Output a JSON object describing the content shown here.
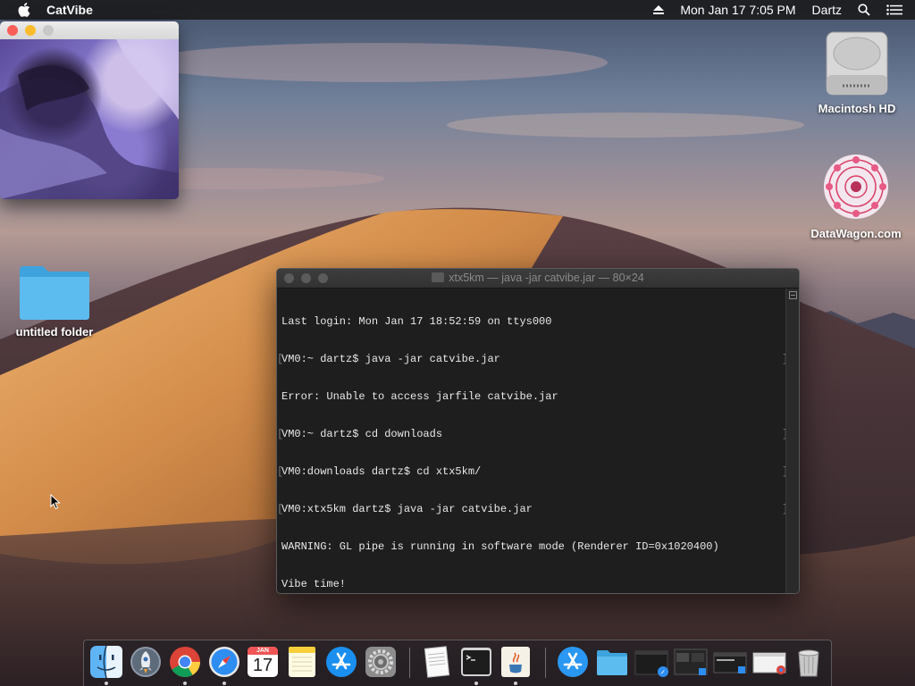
{
  "menubar": {
    "app_name": "CatVibe",
    "datetime": "Mon Jan 17  7:05 PM",
    "user": "Dartz",
    "icons": [
      "apple-icon",
      "eject-icon",
      "search-icon",
      "list-icon"
    ]
  },
  "catvibe_window": {
    "title": ""
  },
  "desktop": {
    "icons": [
      {
        "label": "Macintosh HD",
        "icon": "hard-drive-icon"
      },
      {
        "label": "DataWagon.com",
        "icon": "mandala-image-icon"
      },
      {
        "label": "untitled folder",
        "icon": "folder-icon"
      }
    ]
  },
  "terminal": {
    "title": "xtx5km — java -jar catvibe.jar — 80×24",
    "lines": [
      {
        "text": "Last login: Mon Jan 17 18:52:59 on ttys000",
        "marked": false
      },
      {
        "text": "VM0:~ dartz$ java -jar catvibe.jar",
        "marked": true
      },
      {
        "text": "Error: Unable to access jarfile catvibe.jar",
        "marked": false
      },
      {
        "text": "VM0:~ dartz$ cd downloads",
        "marked": true
      },
      {
        "text": "VM0:downloads dartz$ cd xtx5km/",
        "marked": true
      },
      {
        "text": "VM0:xtx5km dartz$ java -jar catvibe.jar",
        "marked": true
      },
      {
        "text": "WARNING: GL pipe is running in software mode (Renderer ID=0x1020400)",
        "marked": false
      },
      {
        "text": "Vibe time!",
        "marked": false
      }
    ]
  },
  "calendar_dock": {
    "month": "JAN",
    "day": "17"
  },
  "dock": {
    "items": [
      {
        "name": "finder",
        "icon": "finder-icon",
        "running": true
      },
      {
        "name": "launchpad",
        "icon": "rocket-icon",
        "running": false
      },
      {
        "name": "chrome",
        "icon": "chrome-icon",
        "running": true
      },
      {
        "name": "safari",
        "icon": "compass-icon",
        "running": true
      },
      {
        "name": "calendar",
        "icon": "calendar-icon",
        "running": false
      },
      {
        "name": "notes",
        "icon": "notes-icon",
        "running": false
      },
      {
        "name": "app-store",
        "icon": "app-store-icon",
        "running": false
      },
      {
        "name": "system-preferences",
        "icon": "gear-icon",
        "running": false
      },
      {
        "name": "textedit",
        "icon": "paper-icon",
        "running": false
      },
      {
        "name": "terminal",
        "icon": "terminal-icon",
        "running": true
      },
      {
        "name": "java",
        "icon": "java-icon",
        "running": true
      },
      {
        "name": "applications",
        "icon": "app-store-icon",
        "running": false
      },
      {
        "name": "documents",
        "icon": "folder-icon",
        "running": false
      },
      {
        "name": "minimized-1",
        "icon": "window-thumbnail-icon",
        "running": false
      },
      {
        "name": "minimized-2",
        "icon": "window-thumbnail-icon",
        "running": false
      },
      {
        "name": "minimized-3",
        "icon": "window-thumbnail-icon",
        "running": false
      },
      {
        "name": "minimized-4",
        "icon": "window-thumbnail-icon",
        "running": false
      },
      {
        "name": "trash",
        "icon": "trash-icon",
        "running": false
      }
    ]
  },
  "colors": {
    "close": "#fc5f57",
    "minimize": "#fdbc2e",
    "zoom_inactive": "#c8c8c8",
    "terminal_bg": "#1e1e1e",
    "terminal_text": "#e8e8e8"
  }
}
